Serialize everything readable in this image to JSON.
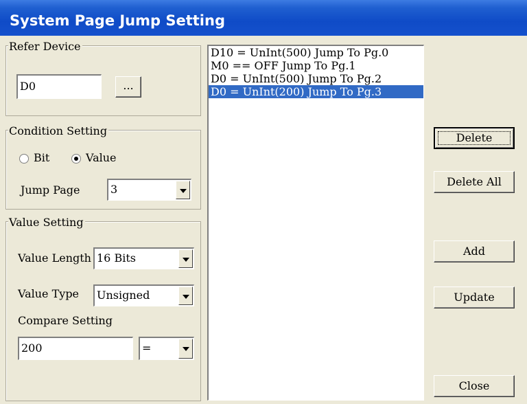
{
  "window": {
    "title": "System Page Jump Setting"
  },
  "refer_device": {
    "legend": "Refer Device",
    "value": "D0",
    "browse_label": "..."
  },
  "condition": {
    "legend": "Condition Setting",
    "bit_label": "Bit",
    "value_label": "Value",
    "selected": "Value",
    "jump_page_label": "Jump Page",
    "jump_page_value": "3"
  },
  "value_setting": {
    "legend": "Value Setting",
    "length_label": "Value Length",
    "length_value": "16 Bits",
    "type_label": "Value Type",
    "type_value": "Unsigned",
    "compare_label": "Compare Setting",
    "compare_value": "200",
    "operator_value": "="
  },
  "list": {
    "items": [
      "D10 = UnInt(500) Jump To Pg.0",
      "M0 == OFF Jump To Pg.1",
      "D0 = UnInt(500) Jump To Pg.2",
      "D0 = UnInt(200) Jump To Pg.3"
    ],
    "selected_index": 3
  },
  "buttons": {
    "delete": "Delete",
    "delete_all": "Delete All",
    "add": "Add",
    "update": "Update",
    "close": "Close"
  },
  "colors": {
    "title_bar": "#0f4bc7",
    "dialog_bg": "#ece9d8",
    "selection": "#316ac5"
  }
}
